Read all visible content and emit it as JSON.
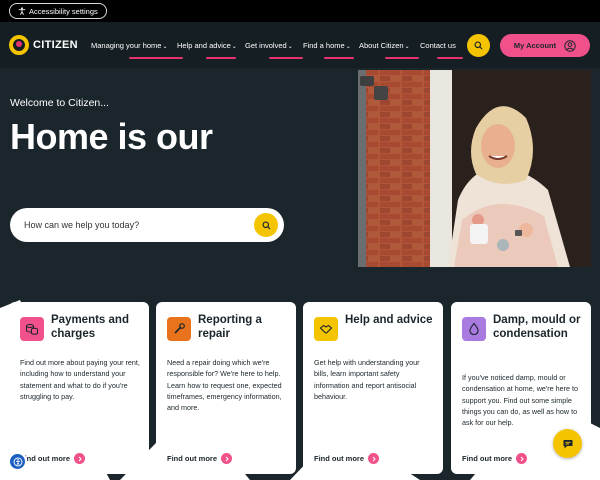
{
  "topbar": {
    "accessibility_label": "Accessibility settings"
  },
  "header": {
    "logo_text": "CITIZEN",
    "nav": [
      {
        "label": "Managing your home",
        "has_dropdown": true
      },
      {
        "label": "Help and advice",
        "has_dropdown": true
      },
      {
        "label": "Get involved",
        "has_dropdown": true
      },
      {
        "label": "Find a home",
        "has_dropdown": true
      },
      {
        "label": "About Citizen",
        "has_dropdown": true
      },
      {
        "label": "Contact us",
        "has_dropdown": false
      }
    ],
    "account_label": "My Account"
  },
  "hero": {
    "welcome": "Welcome to Citizen...",
    "title": "Home is our",
    "search_placeholder": "How can we help you today?"
  },
  "cards": [
    {
      "title": "Payments and charges",
      "body": "Find out more about paying your rent, including how to understand your statement and what to do if you're struggling to pay.",
      "link": "Find out more",
      "icon": "coins-icon",
      "color": "#f0518a"
    },
    {
      "title": "Reporting a repair",
      "body": "Need a repair doing which we're responsible for? We're here to help. Learn how to request one, expected timeframes, emergency information, and more.",
      "link": "Find out more",
      "icon": "wrench-icon",
      "color": "#e8731c"
    },
    {
      "title": "Help and advice",
      "body": "Get help with understanding your bills, learn important safety information and report antisocial behaviour.",
      "link": "Find out more",
      "icon": "handshake-icon",
      "color": "#f5c400"
    },
    {
      "title": "Damp, mould or condensation",
      "body": "If you've noticed damp, mould or condensation at home, we're here to support you. Find out some simple things you can do, as well as how to ask for our help.",
      "link": "Find out more",
      "icon": "water-drop-icon",
      "color": "#a97be0"
    }
  ],
  "colors": {
    "brand_yellow": "#f5c400",
    "brand_pink": "#f0518a",
    "dark_bg": "#1b262c"
  }
}
